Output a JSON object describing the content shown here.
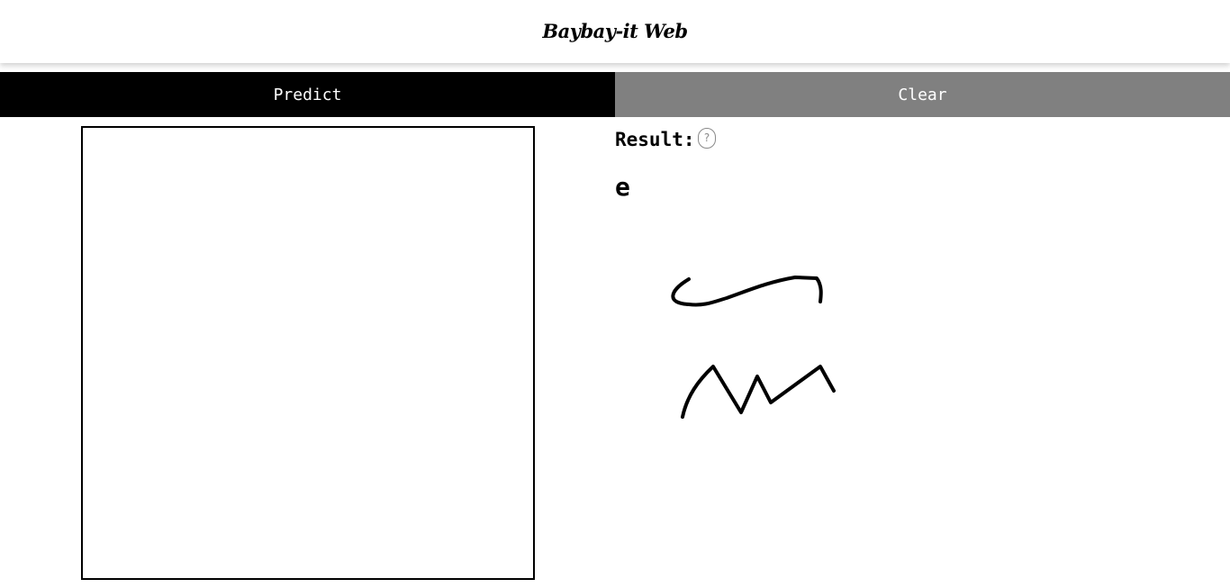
{
  "header": {
    "title": "Baybay-it Web"
  },
  "toolbar": {
    "predict_label": "Predict",
    "clear_label": "Clear"
  },
  "result": {
    "label": "Result:",
    "help_label": "?",
    "value": "e"
  },
  "colors": {
    "predict_bg": "#000000",
    "clear_bg": "#808080",
    "button_text": "#ffffff",
    "stroke": "#000000"
  }
}
